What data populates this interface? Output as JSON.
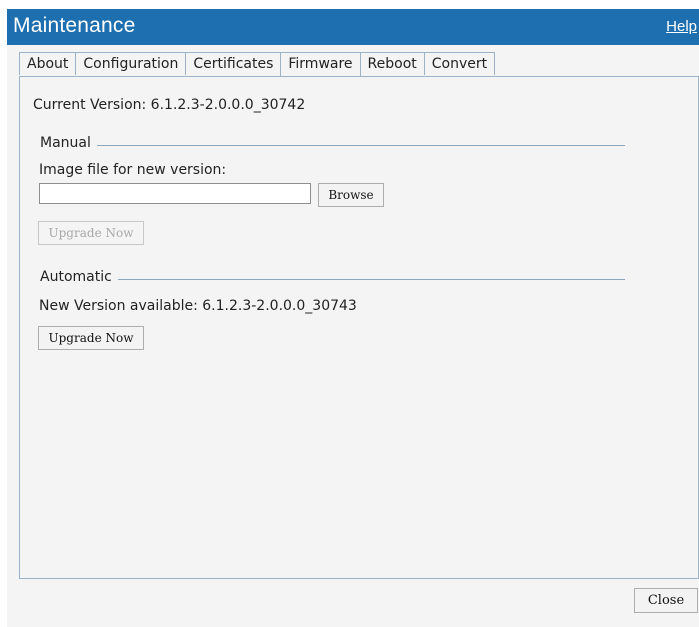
{
  "window": {
    "title": "Maintenance",
    "help_label": "Help"
  },
  "tabs": [
    {
      "label": "About"
    },
    {
      "label": "Configuration"
    },
    {
      "label": "Certificates"
    },
    {
      "label": "Firmware",
      "active": true
    },
    {
      "label": "Reboot"
    },
    {
      "label": "Convert"
    }
  ],
  "firmware": {
    "current_version": "Current Version: 6.1.2.3-2.0.0.0_30742",
    "manual": {
      "legend": "Manual",
      "image_label": "Image file for new version:",
      "file_value": "",
      "browse_label": "Browse",
      "upgrade_label": "Upgrade Now",
      "upgrade_disabled": true
    },
    "automatic": {
      "legend": "Automatic",
      "new_version": "New Version available: 6.1.2.3-2.0.0.0_30743",
      "upgrade_label": "Upgrade Now"
    }
  },
  "footer": {
    "close_label": "Close"
  },
  "colors": {
    "titlebar": "#1d6fb0",
    "border": "#9eb2c6",
    "background": "#f4f4f4"
  }
}
